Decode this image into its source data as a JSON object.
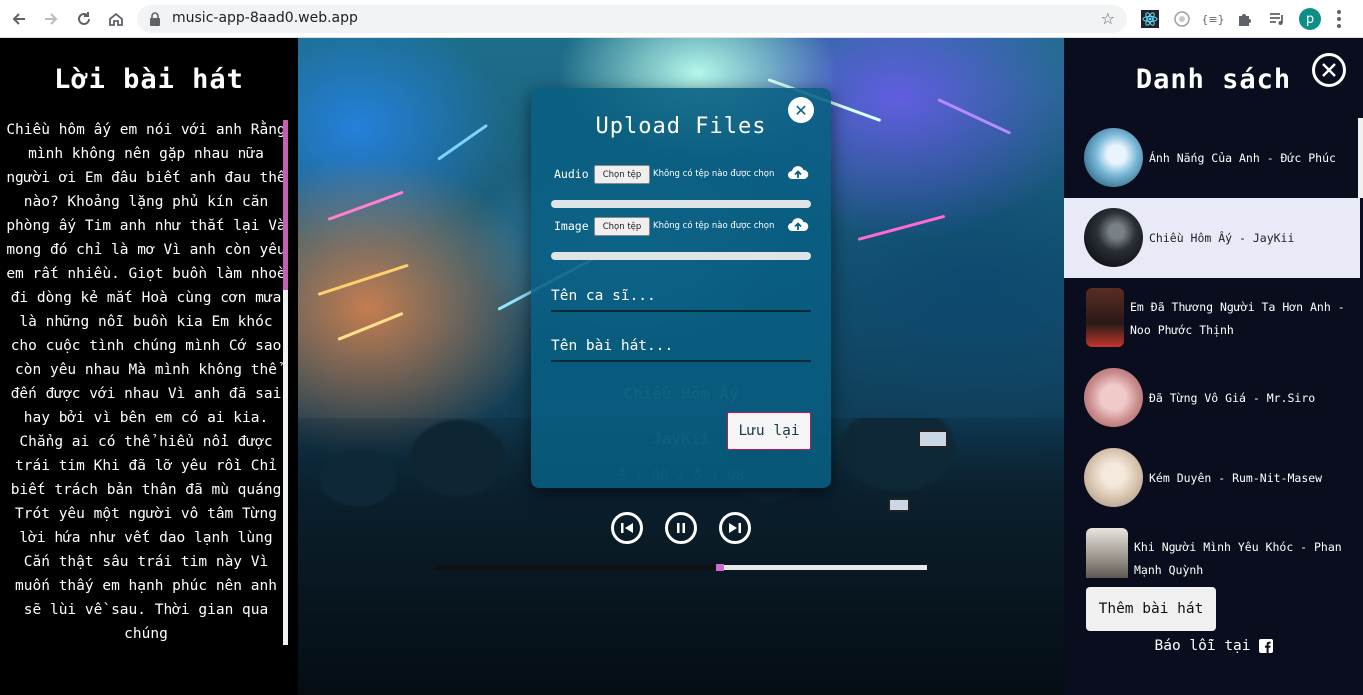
{
  "browser": {
    "url": "music-app-8aad0.web.app",
    "profile_initial": "p",
    "extension_json_label": "{≡}"
  },
  "lyrics": {
    "title": "Lời bài hát",
    "text": "Chiều hôm ấy em nói với anh Rằng mình không nên gặp nhau nữa người ơi Em đâu biết anh đau thế nào? Khoảng lặng phủ kín căn phòng ấy Tim anh như thắt lại Và mong đó chỉ là mơ Vì anh còn yêu em rất nhiều. Giọt buồn làm nhoè đi dòng kẻ mắt Hoà cùng cơn mưa là những nỗi buồn kia Em khóc cho cuộc tình chúng mình Cớ sao còn yêu nhau Mà mình không thể đến được với nhau Vì anh đã sai hay bởi vì bên em có ai kia. Chẳng ai có thể hiểu nổi được trái tim Khi đã lỡ yêu rồi Chỉ biết trách bản thân đã mù quáng Trót yêu một người vô tâm Từng lời hứa như vết dao lạnh lùng Cắn thật sâu trái tim này Vì muốn thấy em hạnh phúc nên anh sẽ lùi về sau. Thời gian qua chúng",
    "scroll_position": 0
  },
  "player": {
    "song_title": "Chiều Hôm Ấy",
    "artist": "JayKii",
    "time": "3 : 00 / 5 : 08",
    "progress": 0.58,
    "controls": {
      "prev": "previous",
      "pause": "pause",
      "next": "next"
    }
  },
  "upload_modal": {
    "title": "Upload Files",
    "audio_label": "Audio",
    "image_label": "Image",
    "choose_file": "Chọn tệp",
    "no_file": "Không có tệp nào được chọn",
    "singer_placeholder": "Tên ca sĩ...",
    "song_placeholder": "Tên bài hát...",
    "save_label": "Lưu lại",
    "audio_upload_progress": 0,
    "image_upload_progress": 0
  },
  "playlist": {
    "title": "Danh sách",
    "items": [
      {
        "label": "Ánh Nắng Của Anh - Đức Phúc",
        "active": false
      },
      {
        "label": "Chiều Hôm Ấy - JayKii",
        "active": true
      },
      {
        "label": "Em Đã Thương Người Ta Hơn Anh - Noo Phước Thịnh",
        "active": false
      },
      {
        "label": "Đã Từng Vô Giá - Mr.Siro",
        "active": false
      },
      {
        "label": "Kém Duyên - Rum-Nit-Masew",
        "active": false
      },
      {
        "label": "Khi Người Mình Yêu Khóc - Phan Mạnh Quỳnh",
        "active": false
      }
    ],
    "add_label": "Thêm bài hát",
    "report_label": "Báo lỗi tại"
  },
  "colors": {
    "accent": "#d06ad0",
    "modal_bg": "#085f82",
    "active_item_bg": "#e8eaf8",
    "save_border": "#c2185b"
  }
}
